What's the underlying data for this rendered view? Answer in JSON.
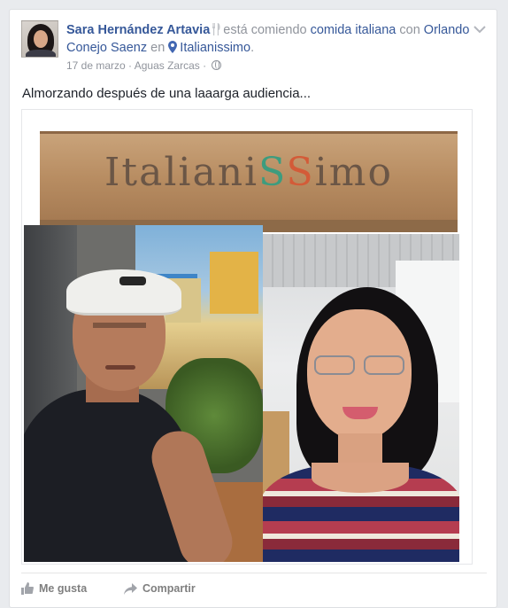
{
  "post": {
    "author": "Sara Hernández Artavia",
    "activity_text": "está comiendo",
    "activity_object": "comida italiana",
    "with_word": "con",
    "tagged_person": "Orlando Conejo Saenz",
    "at_word": "en",
    "place": "Italianissimo",
    "date": "17 de marzo",
    "location": "Aguas Zarcas",
    "separator": "·",
    "message": "Almorzando después de una laaarga audiencia...",
    "icons": {
      "activity": "fork-knife-icon",
      "place": "map-pin-icon",
      "privacy": "globe-icon",
      "options": "chevron-down-icon"
    }
  },
  "photo": {
    "sign_text_1": "Italiani",
    "sign_text_2": "S",
    "sign_text_3": "S",
    "sign_text_4": "imo"
  },
  "actions": {
    "like_label": "Me gusta",
    "share_label": "Compartir"
  },
  "colors": {
    "link": "#365899",
    "muted": "#90949c",
    "text": "#1d2129"
  }
}
